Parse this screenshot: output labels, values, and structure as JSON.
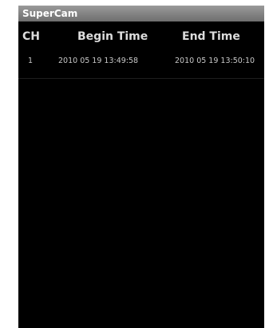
{
  "app": {
    "title": "SuperCam"
  },
  "table": {
    "headers": {
      "channel": "CH",
      "begin": "Begin Time",
      "end": "End Time"
    },
    "rows": [
      {
        "channel": "1",
        "begin": "2010 05 19 13:49:58",
        "end": "2010 05 19 13:50:10"
      }
    ]
  },
  "colors": {
    "background": "#000000",
    "title_bar": "#7a7a7a",
    "header_text": "#dcdcdc",
    "row_text": "#c8c8c8"
  }
}
